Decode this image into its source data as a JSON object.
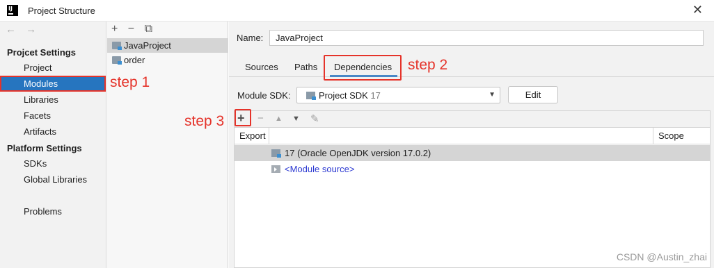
{
  "window": {
    "title": "Project Structure",
    "app_icon_text": "IJ",
    "close_glyph": "✕"
  },
  "nav": {
    "back_glyph": "←",
    "forward_glyph": "→",
    "project_settings_header": "Projcet Settings",
    "platform_settings_header": "Platform Settings",
    "items": [
      {
        "label": "Project"
      },
      {
        "label": "Modules"
      },
      {
        "label": "Libraries"
      },
      {
        "label": "Facets"
      },
      {
        "label": "Artifacts"
      },
      {
        "label": "SDKs"
      },
      {
        "label": "Global Libraries"
      },
      {
        "label": "Problems"
      }
    ],
    "selected": "Modules"
  },
  "modules_panel": {
    "add_glyph": "+",
    "remove_glyph": "−",
    "copy_glyph": "⧉",
    "items": [
      {
        "label": "JavaProject"
      },
      {
        "label": "order"
      }
    ],
    "selected": "JavaProject"
  },
  "detail": {
    "name_label": "Name:",
    "name_value": "JavaProject",
    "tabs": [
      {
        "label": "Sources"
      },
      {
        "label": "Paths"
      },
      {
        "label": "Dependencies"
      }
    ],
    "active_tab": "Dependencies",
    "module_sdk_label": "Module SDK:",
    "module_sdk_value": "Project SDK",
    "module_sdk_version": "17",
    "edit_button": "Edit",
    "dep_toolbar": {
      "add_glyph": "+",
      "remove_glyph": "−",
      "up_glyph": "▲",
      "down_glyph": "▼",
      "edit_glyph": "✎"
    },
    "table": {
      "columns": [
        "Export",
        "",
        "Scope"
      ],
      "rows": [
        {
          "text": "17 (Oracle OpenJDK version 17.0.2)",
          "icon": "jdk-folder-icon"
        },
        {
          "text": "<Module source>",
          "icon": "source-folder-icon"
        }
      ]
    }
  },
  "annotations": {
    "step1": "step 1",
    "step2": "step 2",
    "step3": "step 3",
    "color": "#e5332a"
  },
  "watermark": "CSDN @Austin_zhai",
  "colors": {
    "selection_blue": "#2675bf",
    "link_blue": "#2a37d1",
    "tab_underline": "#4a88c7"
  }
}
